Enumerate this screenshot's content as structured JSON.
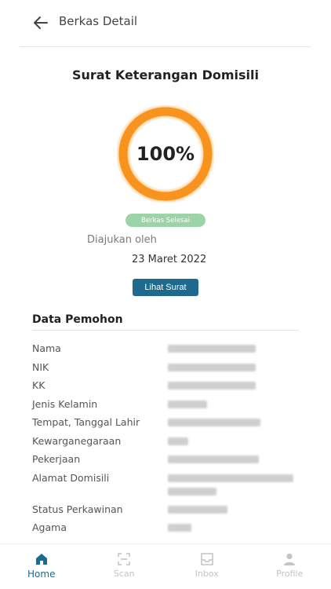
{
  "header": {
    "title": "Berkas Detail"
  },
  "document": {
    "title": "Surat Keterangan Domisili",
    "progress_text": "100%",
    "progress_fraction": 1.0,
    "status_badge": "Berkas Selesai",
    "submitted_label": "Diajukan oleh",
    "submitted_date": "23 Maret 2022",
    "view_button": "Lihat Surat"
  },
  "applicant": {
    "section_title": "Data Pemohon",
    "fields": [
      {
        "label": "Nama"
      },
      {
        "label": "NIK"
      },
      {
        "label": "KK"
      },
      {
        "label": "Jenis Kelamin"
      },
      {
        "label": "Tempat, Tanggal Lahir"
      },
      {
        "label": "Kewarganegaraan"
      },
      {
        "label": "Pekerjaan"
      },
      {
        "label": "Alamat Domisili"
      },
      {
        "label": "Status Perkawinan"
      },
      {
        "label": "Agama"
      }
    ]
  },
  "nav": {
    "items": [
      {
        "label": "Home",
        "icon": "home-icon"
      },
      {
        "label": "Scan",
        "icon": "scan-icon"
      },
      {
        "label": "Inbox",
        "icon": "inbox-icon"
      },
      {
        "label": "Profile",
        "icon": "profile-icon"
      }
    ]
  },
  "colors": {
    "accent": "#1d6a8c",
    "progress_ring": "#f7931e",
    "badge_green": "#9cd3a7",
    "inactive_nav": "#c4c4c4"
  }
}
